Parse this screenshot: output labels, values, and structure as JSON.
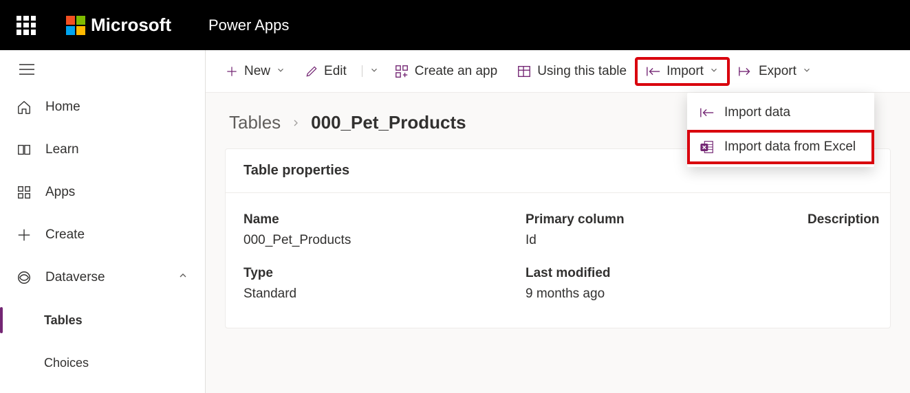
{
  "header": {
    "brand": "Microsoft",
    "app": "Power Apps"
  },
  "sidebar": {
    "items": [
      {
        "label": "Home"
      },
      {
        "label": "Learn"
      },
      {
        "label": "Apps"
      },
      {
        "label": "Create"
      },
      {
        "label": "Dataverse"
      },
      {
        "label": "Tables"
      },
      {
        "label": "Choices"
      }
    ]
  },
  "toolbar": {
    "new_label": "New",
    "edit_label": "Edit",
    "create_app_label": "Create an app",
    "using_table_label": "Using this table",
    "import_label": "Import",
    "export_label": "Export"
  },
  "dropdown": {
    "import_data": "Import data",
    "import_excel": "Import data from Excel"
  },
  "breadcrumb": {
    "root": "Tables",
    "current": "000_Pet_Products"
  },
  "card": {
    "title": "Table properties",
    "labels": {
      "name": "Name",
      "primary_column": "Primary column",
      "description": "Description",
      "type": "Type",
      "last_modified": "Last modified"
    },
    "values": {
      "name": "000_Pet_Products",
      "primary_column": "Id",
      "type": "Standard",
      "last_modified": "9 months ago"
    }
  }
}
